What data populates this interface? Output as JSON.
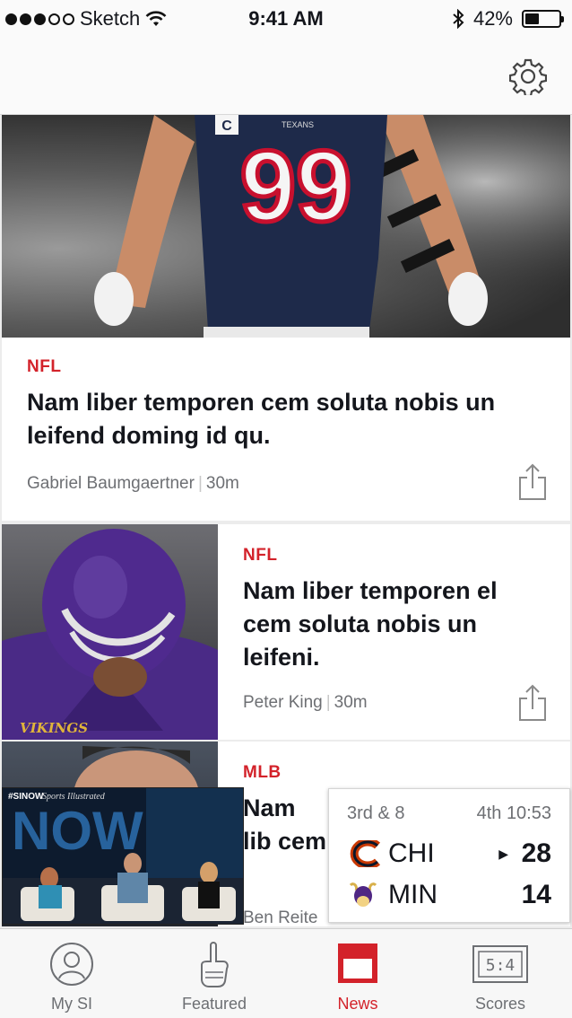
{
  "status_bar": {
    "carrier": "Sketch",
    "time": "9:41 AM",
    "battery": "42%",
    "battery_level": 0.42
  },
  "colors": {
    "accent": "#d3222a",
    "headline": "#14161c",
    "muted": "#6d6f73"
  },
  "articles": [
    {
      "category": "NFL",
      "headline": "Nam liber temporen cem soluta nobis un leifend doming id qu.",
      "author": "Gabriel Baumgaertner",
      "age": "30m"
    },
    {
      "category": "NFL",
      "headline": "Nam liber temporen el cem soluta nobis un leifeni.",
      "author": "Peter King",
      "age": "30m"
    },
    {
      "category": "MLB",
      "headline": "Nam lib cem so",
      "author": "Ben Reite",
      "age": ""
    }
  ],
  "video": {
    "tag": "#SINOW",
    "brand": "Sports Illustrated",
    "title": "NOW"
  },
  "score": {
    "down": "3rd & 8",
    "clock": "4th 10:53",
    "home": {
      "abbr": "CHI",
      "score": "28",
      "has_possession": true
    },
    "away": {
      "abbr": "MIN",
      "score": "14",
      "has_possession": false
    }
  },
  "tabs": [
    {
      "label": "My SI",
      "icon": "user-icon",
      "active": false
    },
    {
      "label": "Featured",
      "icon": "foam-finger-icon",
      "active": false
    },
    {
      "label": "News",
      "icon": "news-icon",
      "active": true
    },
    {
      "label": "Scores",
      "icon": "scoreboard-icon",
      "active": false
    }
  ],
  "scoreboard_icon_text": "5:4"
}
